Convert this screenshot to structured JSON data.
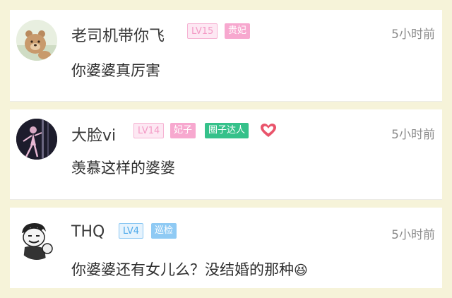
{
  "comments": [
    {
      "username": "老司机带你飞",
      "level": "LV15",
      "title_badge": "贵妃",
      "time": "5小时前",
      "text": "你婆婆真厉害",
      "avatar_icon": "bear-avatar-icon"
    },
    {
      "username": "大脸vi",
      "level": "LV14",
      "title_badge": "妃子",
      "extra_badge": "圈子达人",
      "heart_icon": "heart-icon",
      "time": "5小时前",
      "text": "羡慕这样的婆婆",
      "avatar_icon": "dancer-avatar-icon"
    },
    {
      "username": "THQ",
      "level": "LV4",
      "title_badge": "巡检",
      "time": "5小时前",
      "text": "你婆婆还有女儿么？没结婚的那种",
      "emoji": "😆",
      "avatar_icon": "meme-face-avatar-icon"
    }
  ],
  "colors": {
    "background": "#f6f3d9",
    "pink_badge": "#f7a8cf",
    "blue_badge": "#8fcaf4",
    "green_badge": "#35c18a",
    "heart": "#e9546b"
  }
}
